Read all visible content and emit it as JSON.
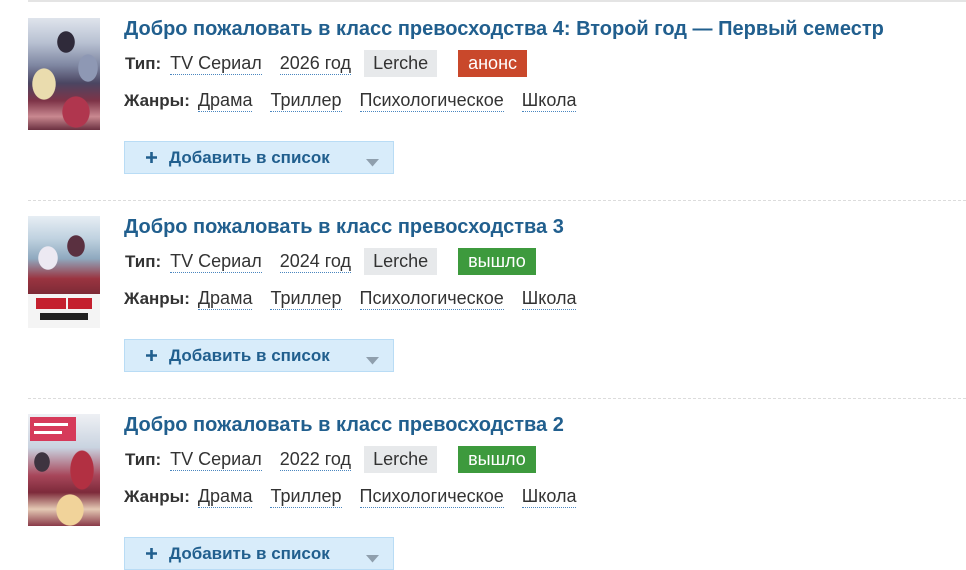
{
  "labels": {
    "type": "Тип:",
    "genres": "Жанры:",
    "add_to_list": "Добавить в список"
  },
  "icons": {
    "add": "plus-icon",
    "dropdown": "caret-down-icon"
  },
  "colors": {
    "title": "#215f8e",
    "button_bg": "#d8ecfa",
    "button_border": "#b9dcf5",
    "studio_bg": "#e7e9eb"
  },
  "entries": [
    {
      "title": "Добро пожаловать в класс превосходства 4: Второй год — Первый семестр",
      "type": "TV Сериал",
      "year": "2026 год",
      "studio": "Lerche",
      "status": "анонс",
      "status_color": "#c9482b",
      "genres": [
        "Драма",
        "Триллер",
        "Психологическое",
        "Школа"
      ]
    },
    {
      "title": "Добро пожаловать в класс превосходства 3",
      "type": "TV Сериал",
      "year": "2024 год",
      "studio": "Lerche",
      "status": "вышло",
      "status_color": "#3d9a3d",
      "genres": [
        "Драма",
        "Триллер",
        "Психологическое",
        "Школа"
      ]
    },
    {
      "title": "Добро пожаловать в класс превосходства 2",
      "type": "TV Сериал",
      "year": "2022 год",
      "studio": "Lerche",
      "status": "вышло",
      "status_color": "#3d9a3d",
      "genres": [
        "Драма",
        "Триллер",
        "Психологическое",
        "Школа"
      ]
    }
  ]
}
